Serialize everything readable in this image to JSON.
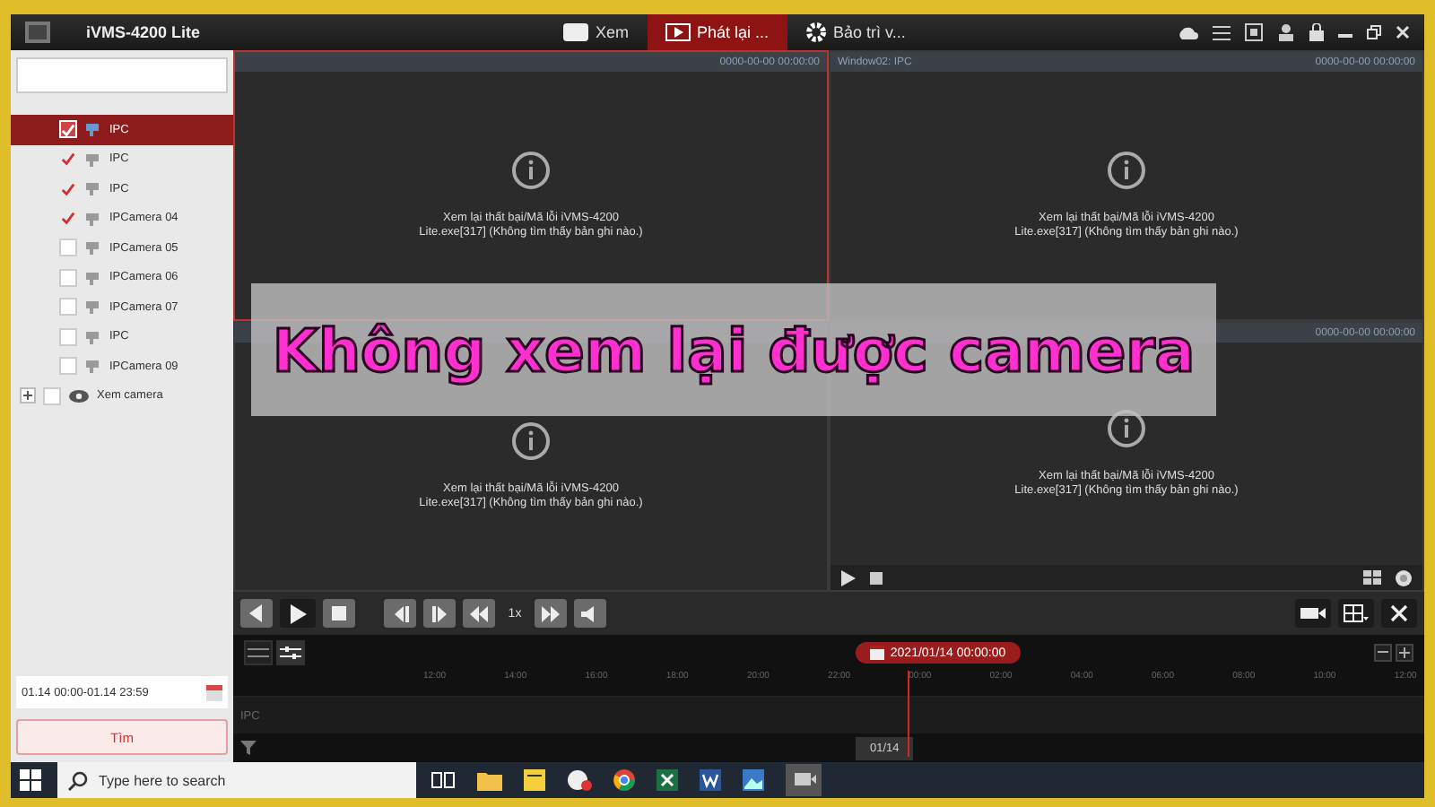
{
  "window": {
    "title": "iVMS-4200 Lite"
  },
  "tabs": [
    {
      "label": "Xem",
      "selected": false
    },
    {
      "label": "Phát lại ...",
      "selected": true
    },
    {
      "label": "Bảo trì v...",
      "selected": false
    }
  ],
  "device_tree": [
    {
      "label": "IPC",
      "kind": "camera",
      "checked": true,
      "selected": true
    },
    {
      "label": "IPC",
      "kind": "camera",
      "checked": true,
      "selected": false
    },
    {
      "label": "IPC",
      "kind": "camera",
      "checked": true,
      "selected": false
    },
    {
      "label": "IPCamera 04",
      "kind": "camera",
      "checked": true,
      "selected": false
    },
    {
      "label": "IPCamera 05",
      "kind": "camera",
      "checked": false,
      "selected": false
    },
    {
      "label": "IPCamera 06",
      "kind": "camera",
      "checked": false,
      "selected": false
    },
    {
      "label": "IPCamera 07",
      "kind": "camera",
      "checked": false,
      "selected": false
    },
    {
      "label": "IPC",
      "kind": "camera",
      "checked": false,
      "selected": false
    },
    {
      "label": "IPCamera 09",
      "kind": "camera",
      "checked": false,
      "selected": false
    },
    {
      "label": "Xem camera",
      "kind": "group",
      "checked": false,
      "selected": false
    }
  ],
  "time_range": {
    "value": "01.14 00:00-01.14 23:59"
  },
  "search_button": "Tìm",
  "panes": [
    {
      "time": "0000-00-00 00:00:00",
      "message": "Xem lại thất bại/Mã lỗi iVMS-4200 Lite.exe[317] (Không tìm thấy bản ghi nào.)"
    },
    {
      "title": "Window02: IPC",
      "time": "0000-00-00 00:00:00",
      "message": "Xem lại thất bại/Mã lỗi iVMS-4200 Lite.exe[317] (Không tìm thấy bản ghi nào.)"
    },
    {
      "message": "Xem lại thất bại/Mã lỗi iVMS-4200 Lite.exe[317] (Không tìm thấy bản ghi nào.)"
    },
    {
      "time": "0000-00-00 00:00:00",
      "message": "Xem lại thất bại/Mã lỗi iVMS-4200 Lite.exe[317] (Không tìm thấy bản ghi nào.)"
    }
  ],
  "speed": "1x",
  "timeline": {
    "date": "2021/01/14 00:00:00",
    "ticks": [
      "12:00",
      "14:00",
      "16:00",
      "18:00",
      "20:00",
      "22:00",
      "00:00",
      "02:00",
      "04:00",
      "06:00",
      "08:00",
      "10:00",
      "12:00"
    ],
    "track_label": "IPC",
    "cursor_label": "01/14"
  },
  "taskbar": {
    "search_placeholder": "Type here to search"
  },
  "banner": "Không xem lại được camera"
}
